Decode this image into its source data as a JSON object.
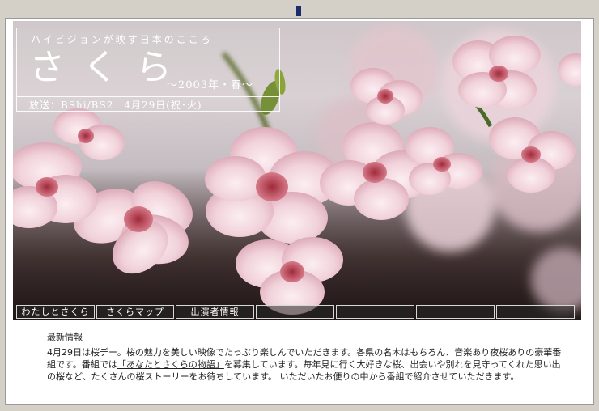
{
  "header": {
    "subtitle": "ハイビジョンが映す日本のこころ",
    "title": "さくら",
    "season": "〜2003年・春〜",
    "broadcast": "放送：BShi/BS2　4月29日(祝･火)"
  },
  "nav": {
    "items": [
      {
        "label": "わたしとさくら"
      },
      {
        "label": "さくらマップ"
      },
      {
        "label": "出演者情報"
      },
      {
        "label": ""
      },
      {
        "label": ""
      },
      {
        "label": ""
      },
      {
        "label": ""
      }
    ]
  },
  "news": {
    "heading": "最新情報",
    "text_before_link": "4月29日は桜デー。桜の魅力を美しい映像でたっぷり楽しんでいただきます。各県の名木はもちろん、音楽あり夜桜ありの豪華番組です。番組では",
    "link": "「あなたとさくらの物語」",
    "text_after_link": "を募集しています。毎年見に行く大好きな桜、出会いや別れを見守ってくれた思い出の桜など、たくさんの桜ストーリーをお待ちしています。 いただいたお便りの中から番組で紹介させていただきます。"
  },
  "colors": {
    "background": "#d4d0c8",
    "blossom": "#f3d6de",
    "blossom_center": "#c2404f",
    "nav_bg": "#3a3a3a"
  }
}
